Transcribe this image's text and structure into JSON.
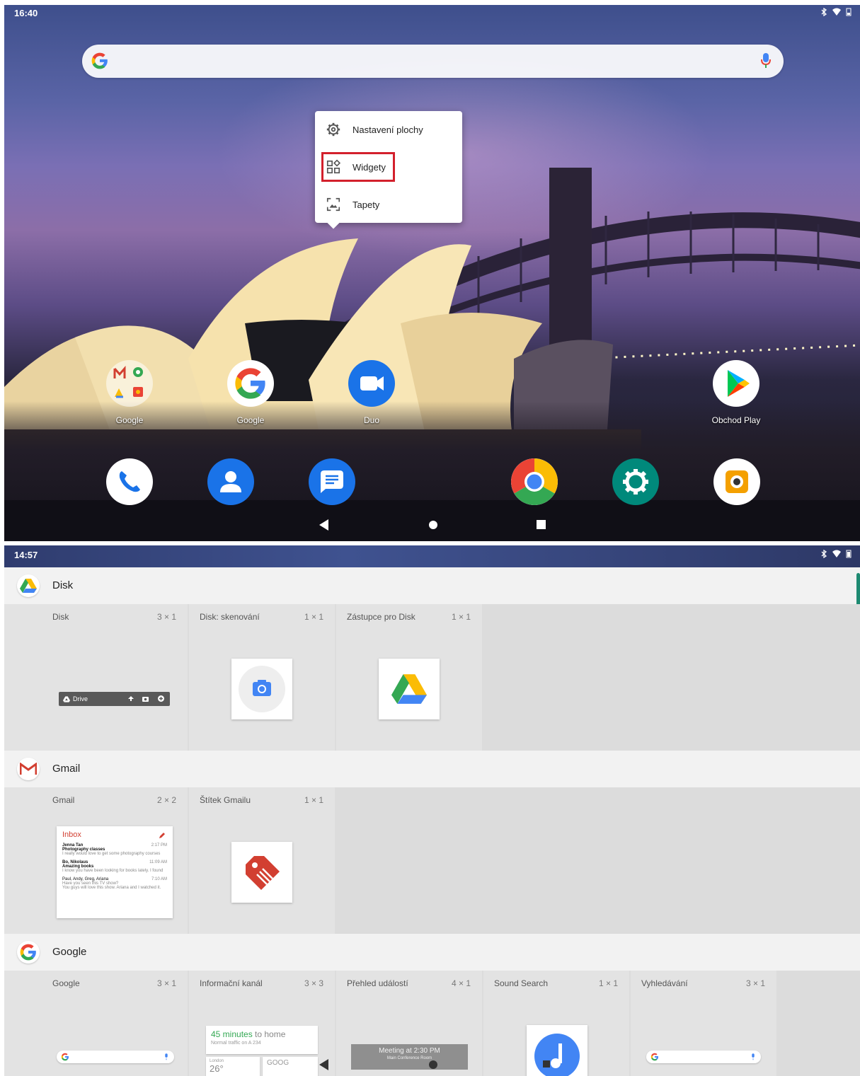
{
  "top": {
    "status": {
      "time": "16:40"
    },
    "menu": {
      "items": [
        {
          "label": "Nastavení plochy",
          "icon": "gear-icon"
        },
        {
          "label": "Widgety",
          "icon": "widgets-icon"
        },
        {
          "label": "Tapety",
          "icon": "wallpaper-icon"
        }
      ]
    },
    "apps": [
      {
        "label": "Google",
        "icon": "google-folder-icon"
      },
      {
        "label": "Google",
        "icon": "google-icon"
      },
      {
        "label": "Duo",
        "icon": "duo-icon"
      },
      {
        "label": "Obchod Play",
        "icon": "play-store-icon"
      }
    ],
    "dock": [
      "phone-icon",
      "contacts-icon",
      "messages-icon",
      "chrome-icon",
      "settings-icon",
      "camera-icon"
    ]
  },
  "bottom": {
    "status": {
      "time": "14:57"
    },
    "sections": [
      {
        "title": "Disk",
        "widgets": [
          {
            "name": "Disk",
            "size": "3 × 1",
            "preview_text": "Drive"
          },
          {
            "name": "Disk: skenování",
            "size": "1 × 1"
          },
          {
            "name": "Zástupce pro Disk",
            "size": "1 × 1"
          }
        ]
      },
      {
        "title": "Gmail",
        "widgets": [
          {
            "name": "Gmail",
            "size": "2 × 2"
          },
          {
            "name": "Štítek Gmailu",
            "size": "1 × 1"
          }
        ],
        "gmail_preview": {
          "header": "Inbox",
          "items": [
            {
              "from": "Jenna Tan",
              "subject": "Photography classes",
              "snippet": "I really would love to get some photography courses",
              "time": "2:17 PM"
            },
            {
              "from": "Bo, Nikolaus",
              "subject": "Amazing books",
              "snippet": "I know you have been looking for books lately. I found",
              "time": "11:09 AM"
            },
            {
              "from": "Paul, Andy, Greg, Ariana",
              "subject": "Have you seen this TV show?",
              "snippet": "You guys will love this show. Ariana and I watched it.",
              "time": "7:10 AM"
            }
          ]
        }
      },
      {
        "title": "Google",
        "widgets": [
          {
            "name": "Google",
            "size": "3 × 1"
          },
          {
            "name": "Informační kanál",
            "size": "3 × 3"
          },
          {
            "name": "Přehled událostí",
            "size": "4 × 1"
          },
          {
            "name": "Sound Search",
            "size": "1 × 1"
          },
          {
            "name": "Vyhledávání",
            "size": "3 × 1"
          }
        ],
        "feed_preview": {
          "headline_highlight": "45 minutes",
          "headline_rest": " to home",
          "sub": "Normal traffic on A 234",
          "city": "London",
          "temp": "26°",
          "stock": "GOOG"
        },
        "event_preview": {
          "title": "Meeting at 2:30 PM",
          "sub": "Main Conference Room"
        }
      }
    ]
  }
}
